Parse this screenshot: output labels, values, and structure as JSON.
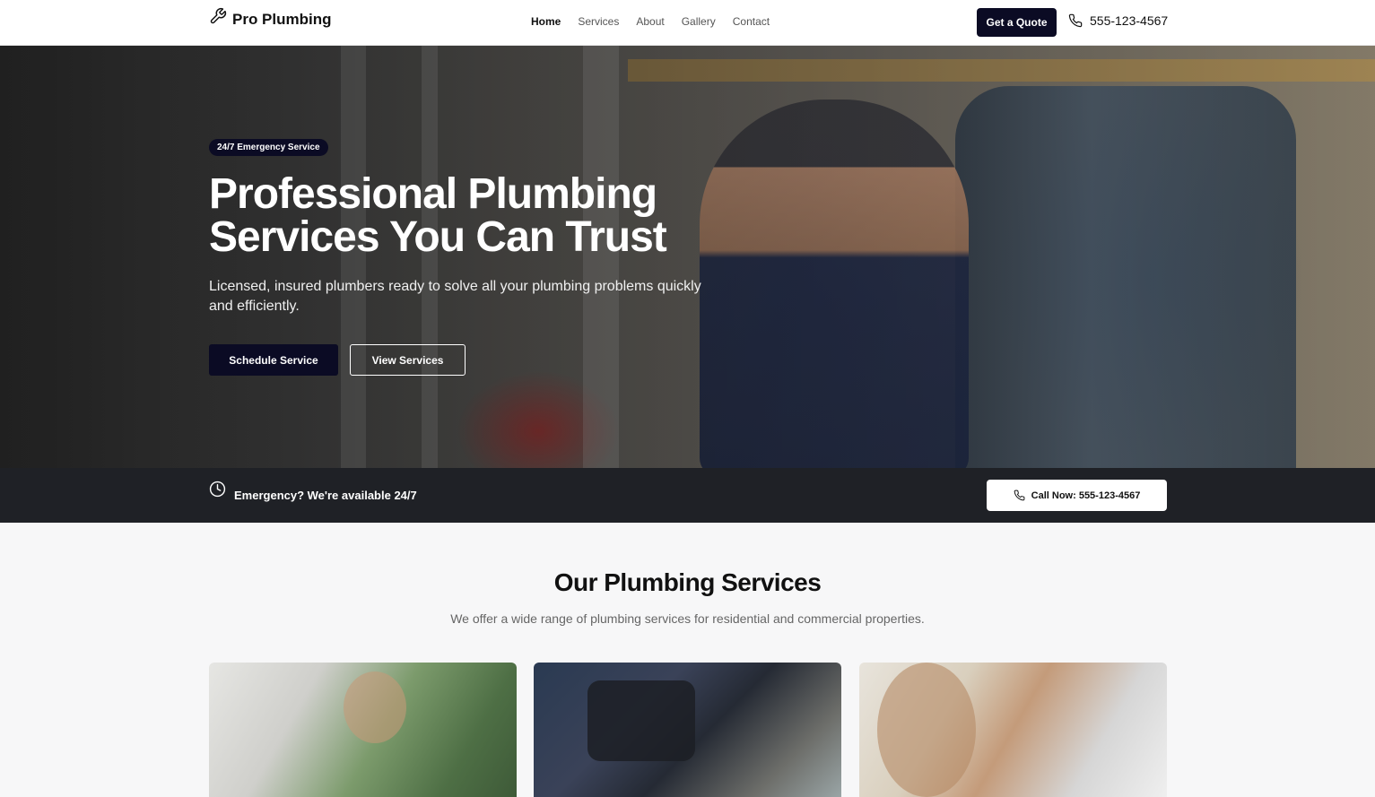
{
  "header": {
    "brand": "Pro Plumbing",
    "logo_icon": "wrench-icon",
    "nav": [
      {
        "label": "Home",
        "active": true
      },
      {
        "label": "Services",
        "active": false
      },
      {
        "label": "About",
        "active": false
      },
      {
        "label": "Gallery",
        "active": false
      },
      {
        "label": "Contact",
        "active": false
      }
    ],
    "quote_button": "Get a Quote",
    "phone_icon": "phone-icon",
    "phone": "555-123-4567"
  },
  "hero": {
    "badge": "24/7 Emergency Service",
    "title_line1": "Professional Plumbing",
    "title_line2": "Services You Can Trust",
    "subtitle": "Licensed, insured plumbers ready to solve all your plumbing problems quickly and efficiently.",
    "primary_button": "Schedule Service",
    "secondary_button": "View Services"
  },
  "emergency_bar": {
    "clock_icon": "clock-icon",
    "text": "Emergency? We're available 24/7",
    "call_button": "Call Now: 555-123-4567"
  },
  "services": {
    "title": "Our Plumbing Services",
    "subtitle": "We offer a wide range of plumbing services for residential and commercial properties."
  },
  "colors": {
    "primary": "#0b0b24",
    "dark_bar": "#1f2126",
    "background": "#f7f7f8"
  }
}
